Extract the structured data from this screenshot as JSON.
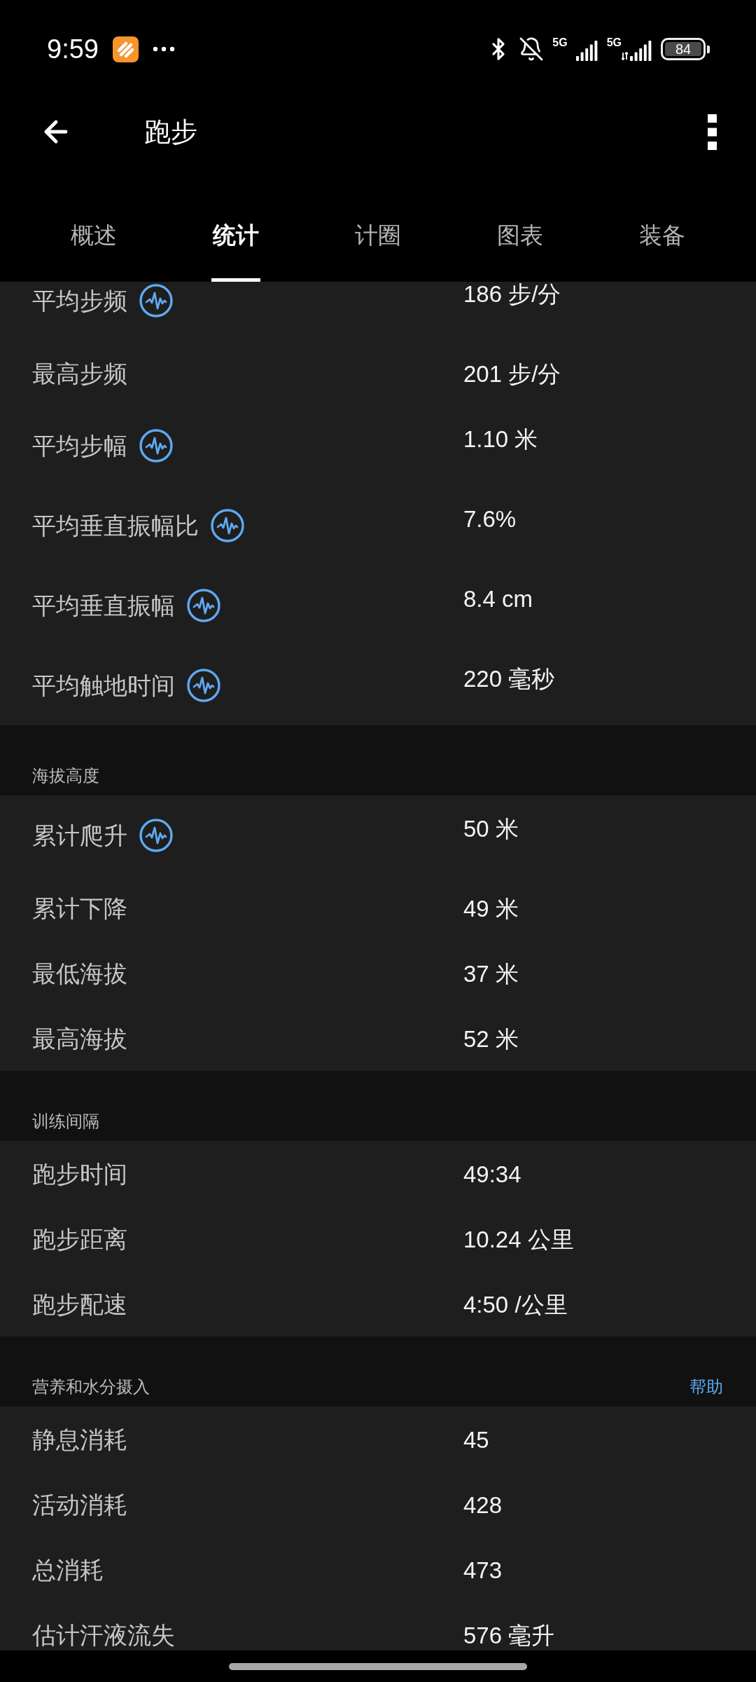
{
  "status_bar": {
    "time": "9:59",
    "network_1": "5G",
    "network_2": "5G",
    "battery": "84"
  },
  "app_bar": {
    "title": "跑步"
  },
  "tabs": [
    {
      "label": "概述",
      "selected": false
    },
    {
      "label": "统计",
      "selected": true
    },
    {
      "label": "计圈",
      "selected": false
    },
    {
      "label": "图表",
      "selected": false
    },
    {
      "label": "装备",
      "selected": false
    }
  ],
  "sections": [
    {
      "rows": [
        {
          "label": "平均步频",
          "value": "186 步/分",
          "chart_icon": true
        },
        {
          "label": "最高步频",
          "value": "201 步/分",
          "chart_icon": false
        },
        {
          "label": "平均步幅",
          "value": "1.10 米",
          "chart_icon": true
        },
        {
          "label": "平均垂直振幅比",
          "value": "7.6%",
          "chart_icon": true
        },
        {
          "label": "平均垂直振幅",
          "value": "8.4 cm",
          "chart_icon": true
        },
        {
          "label": "平均触地时间",
          "value": "220 毫秒",
          "chart_icon": true
        }
      ]
    },
    {
      "title": "海拔高度",
      "rows": [
        {
          "label": "累计爬升",
          "value": "50 米",
          "chart_icon": true
        },
        {
          "label": "累计下降",
          "value": "49 米",
          "chart_icon": false
        },
        {
          "label": "最低海拔",
          "value": "37 米",
          "chart_icon": false
        },
        {
          "label": "最高海拔",
          "value": "52 米",
          "chart_icon": false
        }
      ]
    },
    {
      "title": "训练间隔",
      "rows": [
        {
          "label": "跑步时间",
          "value": "49:34",
          "chart_icon": false
        },
        {
          "label": "跑步距离",
          "value": "10.24 公里",
          "chart_icon": false
        },
        {
          "label": "跑步配速",
          "value": "4:50 /公里",
          "chart_icon": false
        }
      ]
    },
    {
      "title": "营养和水分摄入",
      "link": "帮助",
      "rows": [
        {
          "label": "静息消耗",
          "value": "45",
          "chart_icon": false
        },
        {
          "label": "活动消耗",
          "value": "428",
          "chart_icon": false
        },
        {
          "label": "总消耗",
          "value": "473",
          "chart_icon": false
        },
        {
          "label": "估计汗液流失",
          "value": "576 毫升",
          "chart_icon": false
        }
      ]
    }
  ]
}
